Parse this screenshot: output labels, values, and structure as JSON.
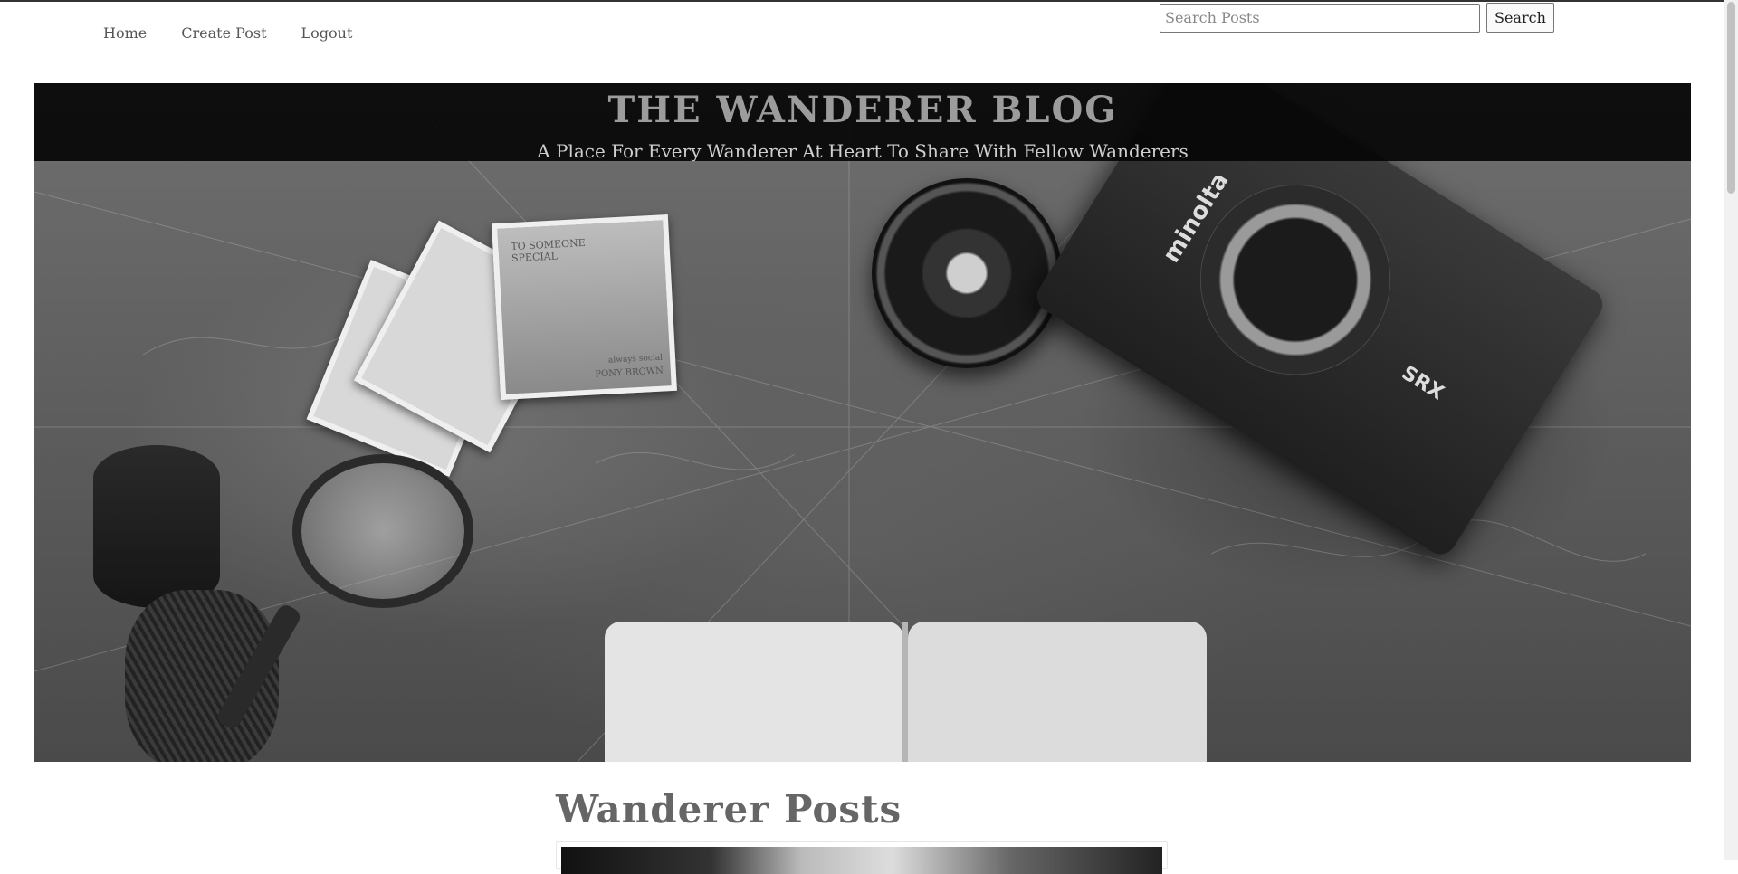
{
  "nav": {
    "links": [
      "Home",
      "Create Post",
      "Logout"
    ]
  },
  "search": {
    "placeholder": "Search Posts",
    "value": "",
    "button_label": "Search"
  },
  "hero": {
    "title": "THE WANDERER BLOG",
    "subtitle": "A Place For Every Wanderer At Heart To Share With Fellow Wanderers",
    "image_text": {
      "postcard_line1": "TO SOMEONE",
      "postcard_line2": "SPECIAL",
      "postcard_footer1": "always social",
      "postcard_footer2": "PONY BROWN",
      "camera_brand": "minolta",
      "camera_model": "SRX"
    }
  },
  "main": {
    "heading": "Wanderer Posts"
  },
  "colors": {
    "page_background": "#ffffff",
    "hero_band": "#050505",
    "title_text": "#9c9c9c"
  }
}
